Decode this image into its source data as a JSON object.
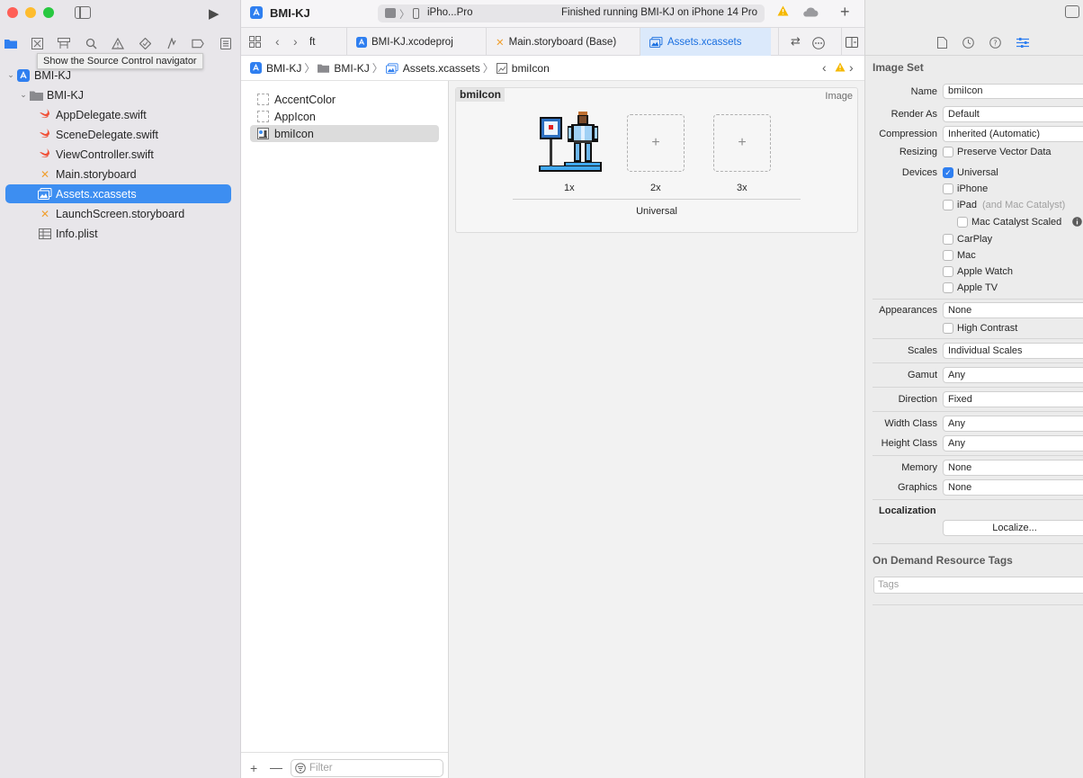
{
  "project": {
    "name": "BMI-KJ",
    "group": "BMI-KJ",
    "files": [
      {
        "name": "AppDelegate.swift",
        "kind": "swift"
      },
      {
        "name": "SceneDelegate.swift",
        "kind": "swift"
      },
      {
        "name": "ViewController.swift",
        "kind": "swift"
      },
      {
        "name": "Main.storyboard",
        "kind": "storyboard"
      },
      {
        "name": "Assets.xcassets",
        "kind": "assets"
      },
      {
        "name": "LaunchScreen.storyboard",
        "kind": "storyboard"
      },
      {
        "name": "Info.plist",
        "kind": "plist"
      }
    ]
  },
  "tooltip": "Show the Source Control navigator",
  "toolbar": {
    "scheme": "BMI-KJ",
    "destination": "iPho...Pro",
    "status": "Finished running BMI-KJ on iPhone 14 Pro"
  },
  "tabs": [
    "ft",
    "BMI-KJ.xcodeproj",
    "Main.storyboard (Base)",
    "Assets.xcassets"
  ],
  "jumpbar": [
    "BMI-KJ",
    "BMI-KJ",
    "Assets.xcassets",
    "bmiIcon"
  ],
  "assets": [
    "AccentColor",
    "AppIcon",
    "bmiIcon"
  ],
  "filter_placeholder": "Filter",
  "imageset": {
    "name": "bmiIcon",
    "type_label": "Image",
    "slots": [
      "1x",
      "2x",
      "3x"
    ],
    "idiom": "Universal"
  },
  "inspector": {
    "section_title": "Image Set",
    "name_label": "Name",
    "name_value": "bmiIcon",
    "render_as_label": "Render As",
    "render_as_value": "Default",
    "compression_label": "Compression",
    "compression_value": "Inherited (Automatic)",
    "resizing_label": "Resizing",
    "resizing_option": "Preserve Vector Data",
    "devices_label": "Devices",
    "devices": {
      "universal": "Universal",
      "iphone": "iPhone",
      "ipad": "iPad",
      "ipad_note": "(and Mac Catalyst)",
      "mac_catalyst_scaled": "Mac Catalyst Scaled",
      "carplay": "CarPlay",
      "mac": "Mac",
      "apple_watch": "Apple Watch",
      "apple_tv": "Apple TV"
    },
    "appearances_label": "Appearances",
    "appearances_value": "None",
    "high_contrast": "High Contrast",
    "scales_label": "Scales",
    "scales_value": "Individual Scales",
    "gamut_label": "Gamut",
    "gamut_value": "Any",
    "direction_label": "Direction",
    "direction_value": "Fixed",
    "width_class_label": "Width Class",
    "width_class_value": "Any",
    "height_class_label": "Height Class",
    "height_class_value": "Any",
    "memory_label": "Memory",
    "memory_value": "None",
    "graphics_label": "Graphics",
    "graphics_value": "None",
    "localization_title": "Localization",
    "localize_button": "Localize...",
    "odr_title": "On Demand Resource Tags",
    "tags_placeholder": "Tags"
  },
  "colors": {
    "accent": "#3d8ef1",
    "close": "#ff5f57",
    "minimize": "#febc2e",
    "zoom": "#28c840",
    "warning": "#f5b800"
  }
}
